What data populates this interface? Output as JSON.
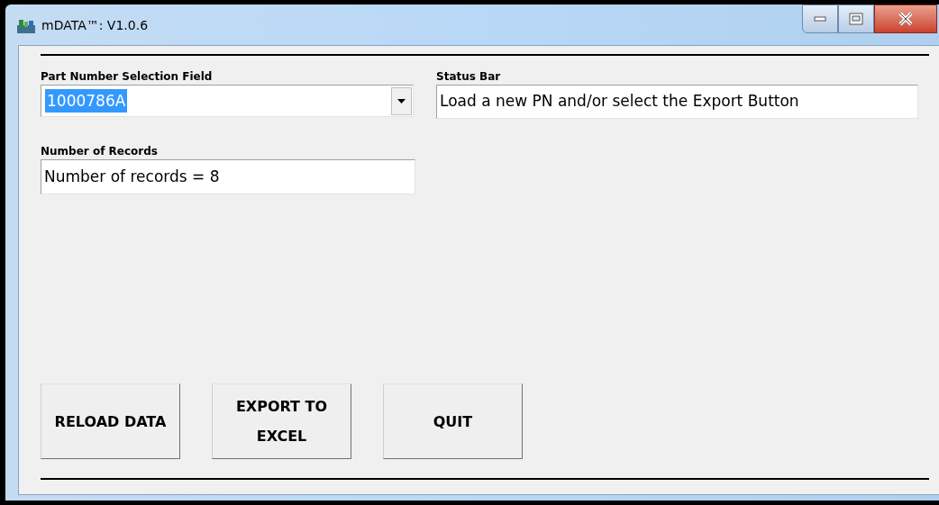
{
  "window": {
    "title": "mDATA™: V1.0.6"
  },
  "part_number": {
    "label": "Part Number Selection Field",
    "value": "1000786A",
    "text_selected": true
  },
  "status_bar": {
    "label": "Status Bar",
    "value": "Load a new PN and/or select the Export Button"
  },
  "records": {
    "label": "Number of Records",
    "value": "Number of records = 8"
  },
  "buttons": [
    {
      "label": "RELOAD DATA"
    },
    {
      "label": "EXPORT TO EXCEL"
    },
    {
      "label": "QUIT"
    }
  ]
}
